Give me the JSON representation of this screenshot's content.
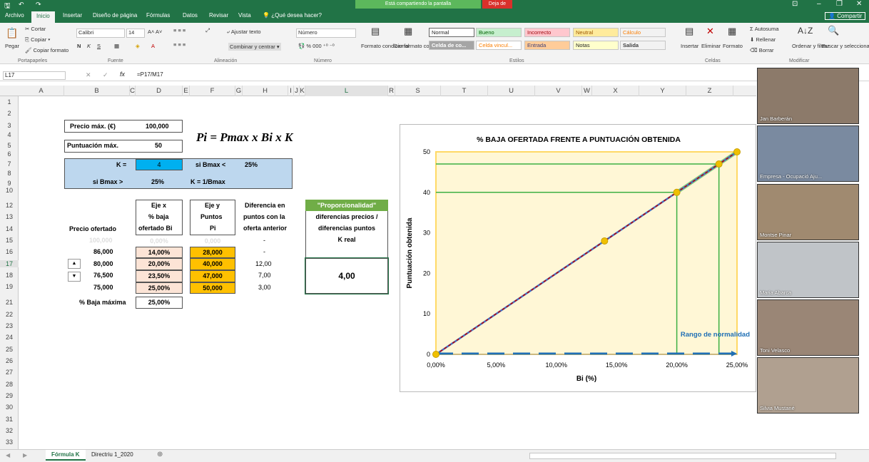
{
  "titlebar": {
    "share_notice": "Está compartiendo la pantalla",
    "stop_share": "Deja de"
  },
  "ribbon_tabs": [
    "Archivo",
    "Inicio",
    "Insertar",
    "Diseño de página",
    "Fórmulas",
    "Datos",
    "Revisar",
    "Vista",
    "¿Qué desea hacer?"
  ],
  "share_button": "Compartir",
  "clipboard": {
    "paste": "Pegar",
    "cut": "Cortar",
    "copy": "Copiar",
    "format_painter": "Copiar formato",
    "group": "Portapapeles"
  },
  "font": {
    "name": "Calibri",
    "size": "14",
    "group": "Fuente"
  },
  "alignment": {
    "wrap": "Ajustar texto",
    "merge": "Combinar y centrar",
    "group": "Alineación"
  },
  "number": {
    "format": "Número",
    "group": "Número"
  },
  "styles": {
    "conditional": "Formato condicional",
    "as_table": "Dar formato como tabla",
    "group": "Estilos",
    "cells": [
      "Normal",
      "Bueno",
      "Incorrecto",
      "Neutral",
      "Cálculo",
      "Celda de co...",
      "Celda vincul...",
      "Entrada",
      "Notas",
      "Salida"
    ]
  },
  "cells_group": {
    "insert": "Insertar",
    "delete": "Eliminar",
    "format": "Formato",
    "group": "Celdas"
  },
  "editing": {
    "autosum": "Autosuma",
    "fill": "Rellenar",
    "clear": "Borrar",
    "sort": "Ordenar y filtrar",
    "find": "Buscar y seleccionar",
    "group": "Modificar"
  },
  "formula_bar": {
    "name_box": "L17",
    "formula": "=P17/M17"
  },
  "columns": [
    "A",
    "B",
    "C",
    "D",
    "E",
    "F",
    "G",
    "H",
    "I",
    "J",
    "K",
    "L",
    "R",
    "S",
    "T",
    "U",
    "V",
    "W",
    "X",
    "Y",
    "Z"
  ],
  "rows": [
    "1",
    "2",
    "3",
    "4",
    "5",
    "6",
    "7",
    "8",
    "9",
    "10",
    "12",
    "13",
    "14",
    "15",
    "16",
    "17",
    "18",
    "19",
    "21",
    "22",
    "23",
    "24",
    "25",
    "26",
    "27",
    "28",
    "29",
    "30",
    "31",
    "32",
    "33"
  ],
  "sheet": {
    "precio_max_label": "Precio máx. (€)",
    "precio_max_value": "100,000",
    "punt_max_label": "Puntuación máx.",
    "punt_max_value": "50",
    "formula_text": "Pi = Pmax x Bi x K",
    "k_label": "K =",
    "k_value": "4",
    "si_bmax_lt": "si Bmax <",
    "pct_25a": "25%",
    "si_bmax_gt": "si Bmax >",
    "pct_25b": "25%",
    "k_formula": "K = 1/Bmax",
    "col_precio": "Precio ofertado",
    "col_eje_x": [
      "Eje x",
      "% baja",
      "ofertado Bi"
    ],
    "col_eje_y": [
      "Eje y",
      "Puntos",
      "Pi"
    ],
    "col_diff": [
      "Diferencia en",
      "puntos con la",
      "oferta anterior"
    ],
    "prop_header": "\"Proporcionalidad\"",
    "prop_sub": [
      "diferencias precios /",
      "diferencias puntos",
      "K real"
    ],
    "prop_value": "4,00",
    "table": [
      {
        "precio": "100,000",
        "baja": "0,00%",
        "pts": "0,000",
        "diff": "-",
        "faded": true
      },
      {
        "precio": "86,000",
        "baja": "14,00%",
        "pts": "28,000",
        "diff": "-"
      },
      {
        "precio": "80,000",
        "baja": "20,00%",
        "pts": "40,000",
        "diff": "12,00"
      },
      {
        "precio": "76,500",
        "baja": "23,50%",
        "pts": "47,000",
        "diff": "7,00"
      },
      {
        "precio": "75,000",
        "baja": "25,00%",
        "pts": "50,000",
        "diff": "3,00"
      }
    ],
    "baja_max_label": "% Baja máxima",
    "baja_max_value": "25,00%"
  },
  "chart_data": {
    "type": "line",
    "title": "% BAJA OFERTADA FRENTE A PUNTUACIÓN OBTENIDA",
    "xlabel": "Bi (%)",
    "ylabel": "Puntuación obtenida",
    "xlim": [
      0,
      25
    ],
    "ylim": [
      0,
      50
    ],
    "x_ticks": [
      "0,00%",
      "5,00%",
      "10,00%",
      "15,00%",
      "20,00%",
      "25,00%"
    ],
    "y_ticks": [
      "0",
      "10",
      "20",
      "30",
      "40",
      "50"
    ],
    "points": [
      {
        "x": 0,
        "y": 0
      },
      {
        "x": 14,
        "y": 28
      },
      {
        "x": 20,
        "y": 40
      },
      {
        "x": 23.5,
        "y": 47
      },
      {
        "x": 25,
        "y": 50
      }
    ],
    "annotation": "Rango de normalidad",
    "colors": {
      "line": "#4472c4",
      "dash": "#c00000",
      "marker": "#f0c000",
      "highlight": "#3cb043",
      "range": "#1f6fb5"
    }
  },
  "sheet_tabs": [
    "Fórmula K",
    "Directriu 1_2020"
  ],
  "participants": [
    "Jan Barberán",
    "Empresa - Ocupació Aju...",
    "Montse Pinar",
    "Maria Abarca",
    "Toni Velasco",
    "Silvia Mustané"
  ]
}
